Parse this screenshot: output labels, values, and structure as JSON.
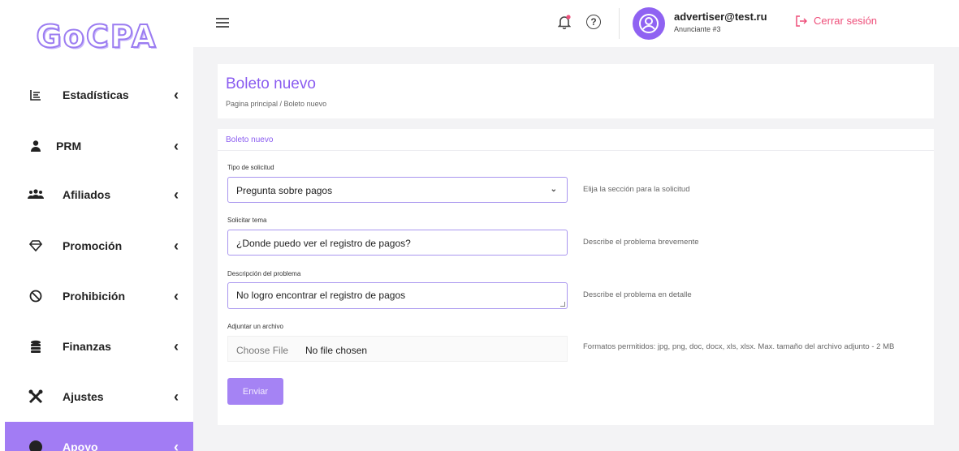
{
  "logo": "GoCPA",
  "sidebar": {
    "items": [
      {
        "label": "Estadísticas",
        "icon": "bar-chart-icon"
      },
      {
        "label": "PRM",
        "icon": "user-icon"
      },
      {
        "label": "Afiliados",
        "icon": "users-icon"
      },
      {
        "label": "Promoción",
        "icon": "diamond-icon"
      },
      {
        "label": "Prohibición",
        "icon": "ban-icon"
      },
      {
        "label": "Finanzas",
        "icon": "coins-icon"
      },
      {
        "label": "Ajustes",
        "icon": "tools-icon"
      },
      {
        "label": "Apoyo",
        "icon": "support-icon"
      }
    ],
    "accent": "#a27cf4"
  },
  "header": {
    "user_email": "advertiser@test.ru",
    "user_role": "Anunciante #3",
    "logout_label": "Cerrar sesión",
    "logout_color": "#ee4f7a"
  },
  "page": {
    "title": "Boleto nuevo",
    "breadcrumb": "Pagina principal  /  Boleto nuevo"
  },
  "form": {
    "heading": "Boleto nuevo",
    "request_type": {
      "label": "Tipo de solicitud",
      "value": "Pregunta sobre pagos",
      "help": "Elija la sección para la solicitud"
    },
    "subject": {
      "label": "Solicitar tema",
      "value": "¿Donde puedo ver el registro de pagos?",
      "help": "Describe el problema brevemente"
    },
    "description": {
      "label": "Descripción del problema",
      "value": "No logro encontrar el registro de pagos",
      "help": "Describe el problema en detalle"
    },
    "attachment": {
      "label": "Adjuntar un archivo",
      "button": "Choose File",
      "status": "No file chosen",
      "help": "Formatos permitidos: jpg, png, doc, docx, xls, xlsx. Max. tamaño del archivo adjunto - 2 MB"
    },
    "submit_label": "Enviar"
  }
}
